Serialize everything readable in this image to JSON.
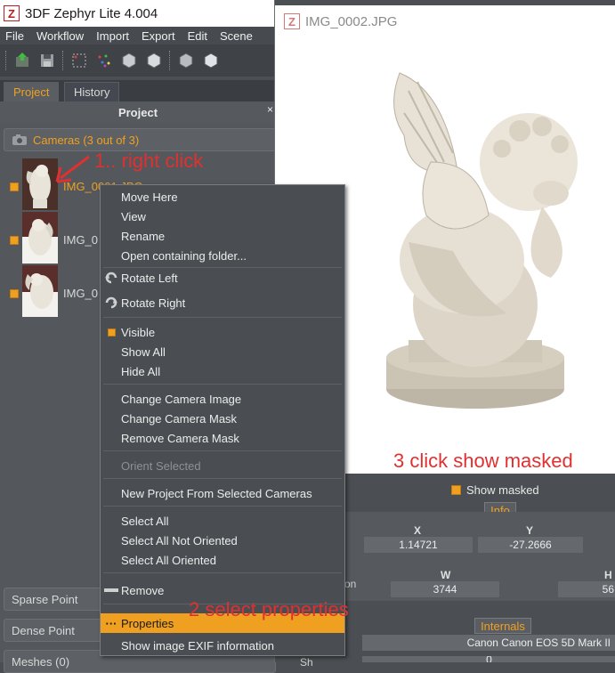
{
  "app": {
    "title": "3DF Zephyr Lite 4.004"
  },
  "menubar": [
    "File",
    "Workflow",
    "Import",
    "Export",
    "Edit",
    "Scene"
  ],
  "toolbar": {
    "icons": [
      "import-icon",
      "save-icon",
      "grid-icon",
      "points-icon",
      "cube-icon",
      "cube-icon",
      "cube-icon",
      "cube-icon"
    ]
  },
  "tabs": [
    {
      "label": "Project",
      "active": true
    },
    {
      "label": "History",
      "active": false
    }
  ],
  "panel": {
    "title": "Project",
    "close": "×",
    "cameras_group": "Cameras (3 out of 3)",
    "cameras": [
      "IMG_0001.JPG",
      "IMG_0",
      "IMG_0"
    ],
    "bottom_groups": [
      "Sparse Point",
      "Dense Point",
      "Meshes (0)"
    ]
  },
  "viewer": {
    "title": "IMG_0002.JPG",
    "show_masked": "Show masked",
    "info_header": "Info",
    "internals_header": "Internals",
    "col_x": "X",
    "col_y": "Y",
    "col_w": "W",
    "col_h": "H",
    "x_value": "1.14721",
    "y_value": "-27.2666",
    "w_value": "3744",
    "h_value": "56",
    "side_label": "on",
    "camera_model": "Canon Canon EOS 5D Mark II",
    "bottom_label": "Sh",
    "bottom_value": "0"
  },
  "context_menu": {
    "items": [
      {
        "label": "Move Here"
      },
      {
        "label": "View"
      },
      {
        "label": "Rename"
      },
      {
        "label": "Open containing folder..."
      },
      {
        "label": "Rotate Left",
        "icon": "rotate-left-icon"
      },
      {
        "label": "Rotate Right",
        "icon": "rotate-right-icon"
      },
      {
        "label": "Visible",
        "icon": "checkbox-icon"
      },
      {
        "label": "Show All"
      },
      {
        "label": "Hide All"
      },
      {
        "label": "Change Camera Image"
      },
      {
        "label": "Change Camera Mask"
      },
      {
        "label": "Remove Camera Mask"
      },
      {
        "label": "Orient Selected",
        "disabled": true
      },
      {
        "label": "New Project From Selected Cameras"
      },
      {
        "label": "Select All"
      },
      {
        "label": "Select All Not Oriented"
      },
      {
        "label": "Select All Oriented"
      },
      {
        "label": "Remove",
        "icon": "minus-icon"
      },
      {
        "label": "Properties",
        "icon": "ellipsis-icon",
        "selected": true
      },
      {
        "label": "Show image EXIF information"
      }
    ]
  },
  "annotations": {
    "step1": "1.. right click",
    "step2": "2 select properties",
    "step3": "3 click show masked"
  },
  "colors": {
    "accent": "#f0a020",
    "annotation": "#e03030",
    "panel": "#54585c"
  }
}
